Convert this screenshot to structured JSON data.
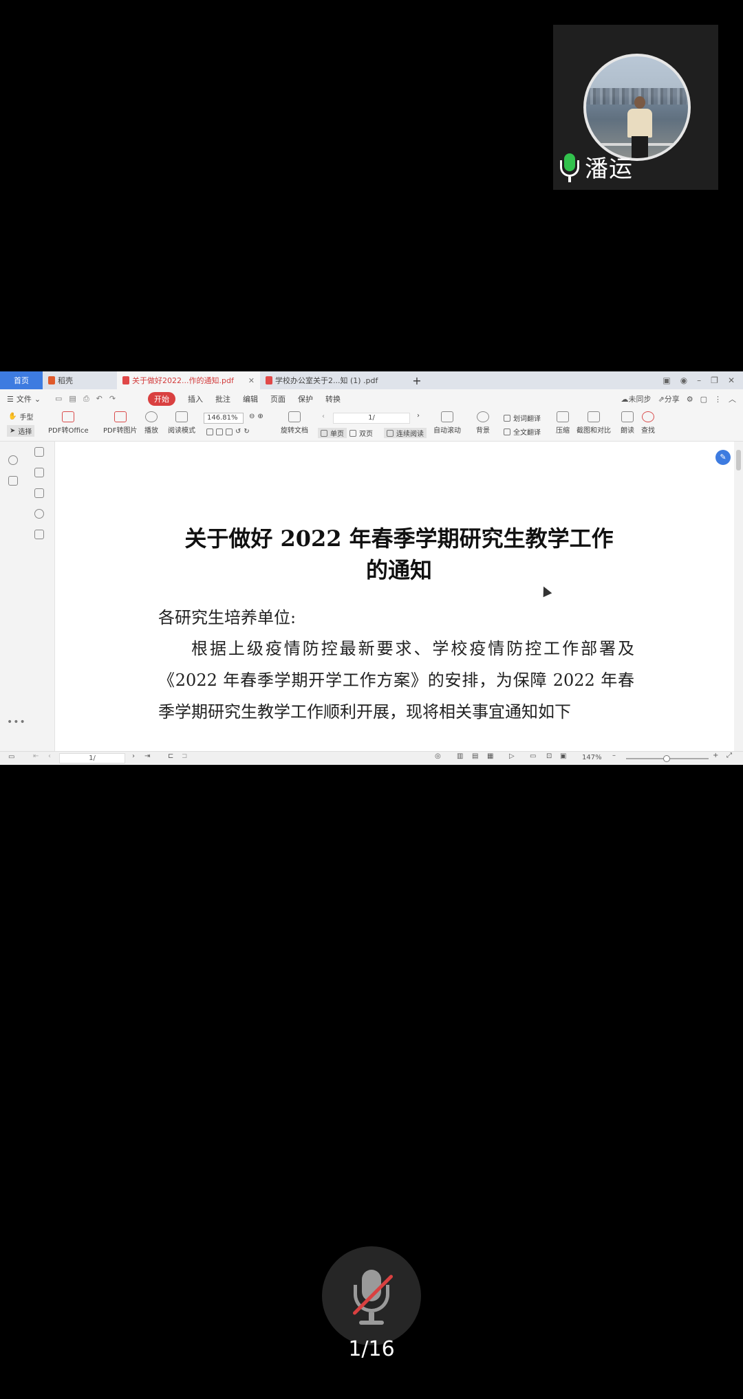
{
  "participant": {
    "name": "潘运"
  },
  "tabs": [
    {
      "label": "首页"
    },
    {
      "label": "稻壳"
    },
    {
      "label": "关于做好2022...作的通知.pdf"
    },
    {
      "label": "学校办公室关于2...知 (1) .pdf"
    }
  ],
  "menu": {
    "file": "文件",
    "items": [
      "开始",
      "插入",
      "批注",
      "编辑",
      "页面",
      "保护",
      "转换"
    ],
    "right": {
      "sync": "未同步",
      "share": "分享"
    }
  },
  "ribbon": {
    "hand": "手型",
    "select": "选择",
    "pdf_to_office": "PDF转Office",
    "pdf_to_image": "PDF转图片",
    "play": "播放",
    "read_mode": "阅读模式",
    "zoom": "146.81%",
    "rotate": "旋转文档",
    "single": "单页",
    "double": "双页",
    "continuous": "连续阅读",
    "page": "1/",
    "auto_scroll": "自动滚动",
    "background": "背景",
    "word_translate": "划词翻译",
    "full_translate": "全文翻译",
    "compress": "压缩",
    "crop_compare": "截图和对比",
    "read_aloud": "朗读",
    "find": "查找"
  },
  "document": {
    "title_line1": "关于做好 2022 年春季学期研究生教学工作",
    "title_line2": "的通知",
    "salutation": "各研究生培养单位:",
    "paragraph": "根据上级疫情防控最新要求、学校疫情防控工作部署及《2022 年春季学期开学工作方案》的安排，为保障 2022 年春季学期研究生教学工作顺利开展，现将相关事宜通知如下"
  },
  "statusbar": {
    "page": "1/",
    "zoom": "147%"
  },
  "share_counter": "1/16"
}
